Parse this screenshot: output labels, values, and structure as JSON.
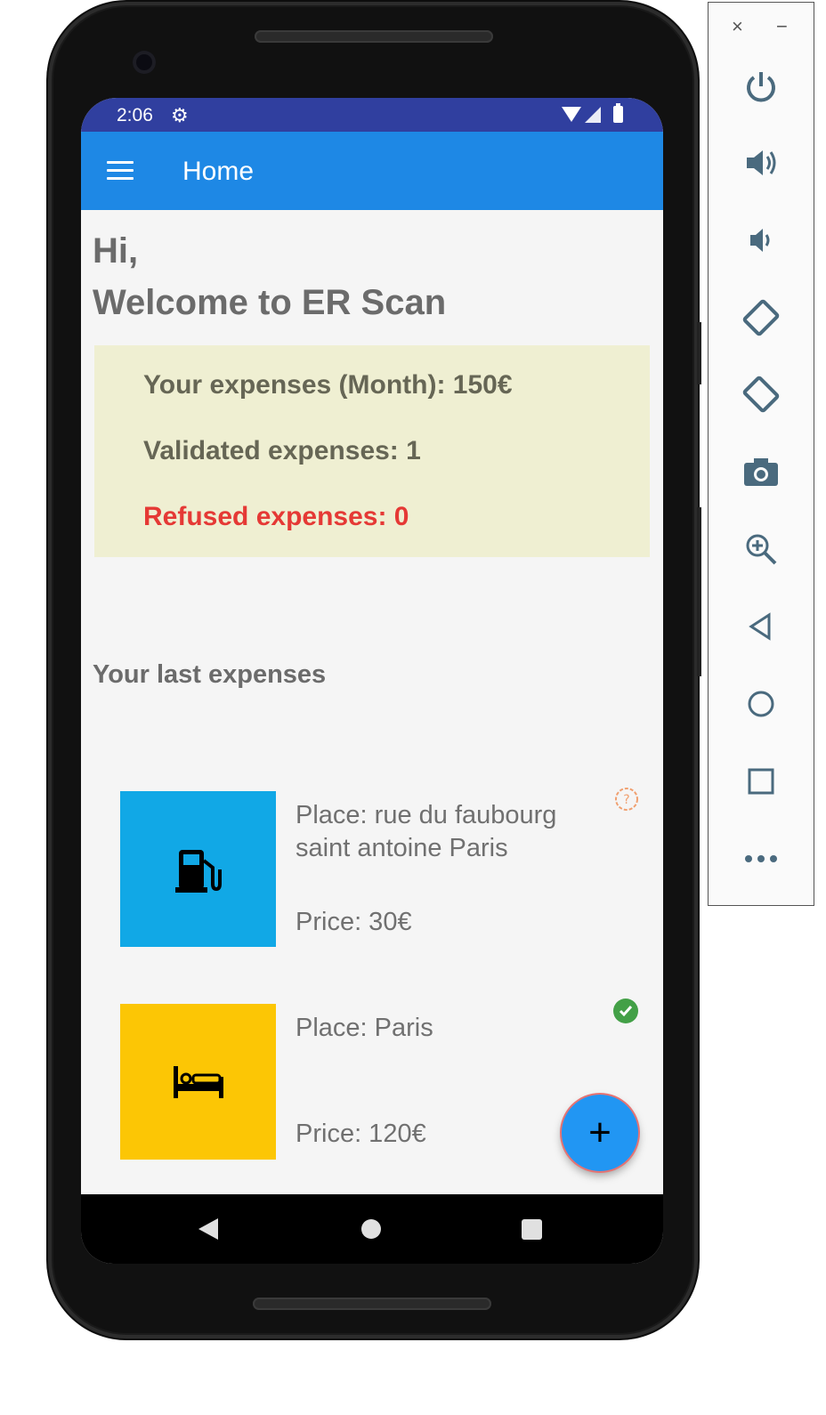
{
  "status_bar": {
    "time": "2:06",
    "icons": [
      "gear-icon",
      "wifi-icon",
      "signal-icon",
      "battery-icon"
    ]
  },
  "app_bar": {
    "title": "Home",
    "menu_icon": "hamburger-menu-icon"
  },
  "greeting": {
    "line1": "Hi,",
    "line2": "Welcome to ER Scan"
  },
  "summary": {
    "monthly": "Your expenses (Month): 150€",
    "validated": "Validated expenses: 1",
    "refused": "Refused expenses: 0"
  },
  "last_expenses_title": "Your last expenses",
  "expenses": [
    {
      "icon": "fuel-pump-icon",
      "color": "#11a8e6",
      "place": "Place: rue du faubourg saint antoine Paris",
      "price": "Price: 30€",
      "status": "pending-icon"
    },
    {
      "icon": "bed-icon",
      "color": "#fcc605",
      "place": "Place: Paris",
      "price": "Price: 120€",
      "status": "validated-icon"
    }
  ],
  "fab": {
    "label": "+"
  },
  "emulator_panel": {
    "top": [
      "×",
      "−"
    ],
    "buttons": [
      "power-icon",
      "volume-up-icon",
      "volume-down-icon",
      "rotate-left-icon",
      "rotate-right-icon",
      "camera-icon",
      "zoom-icon",
      "back-icon",
      "home-icon",
      "overview-icon",
      "more-icon"
    ]
  }
}
